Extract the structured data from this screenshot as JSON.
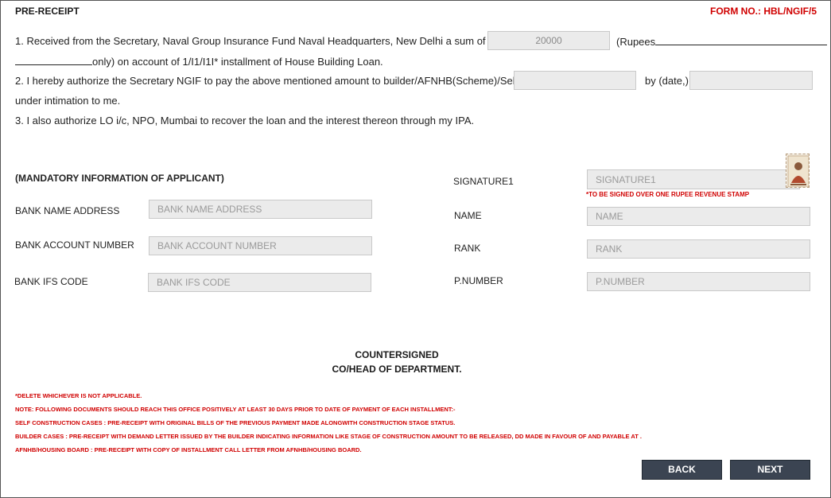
{
  "header": {
    "title": "PRE-RECEIPT",
    "form_no": "FORM NO.: HBL/NGIF/5"
  },
  "clause1": {
    "text_a": "1. Received from the Secretary, Naval Group Insurance Fund Naval Headquarters, New Delhi a sum of Rs",
    "amount_value": "20000",
    "rupees_label": "(Rupees",
    "text_b": "only) on account of 1/I1/I1I* installment of House Building Loan."
  },
  "clause2": {
    "text_a": "2. I hereby authorize the Secretary NGIF to pay the above mentioned amount to builder/AFNHB(Scheme)/Self",
    "by_date_label": "by (date,)",
    "text_b": "under  intimation to me."
  },
  "clause3": {
    "text": "3. I also authorize LO i/c, NPO, Mumbai to recover the loan and the interest thereon through my IPA."
  },
  "applicant": {
    "section_title": "(MANDATORY INFORMATION OF APPLICANT)",
    "bank_name_label": "BANK NAME ADDRESS",
    "bank_name_placeholder": "BANK NAME ADDRESS",
    "bank_account_label": "BANK ACCOUNT NUMBER",
    "bank_account_placeholder": "BANK ACCOUNT NUMBER",
    "bank_ifs_label": "BANK IFS CODE",
    "bank_ifs_placeholder": "BANK IFS CODE"
  },
  "signatory": {
    "signature_label": "SIGNATURE1",
    "signature_placeholder": "SIGNATURE1",
    "stamp_note": "*TO BE SIGNED OVER ONE RUPEE REVENUE STAMP",
    "name_label": "NAME",
    "name_placeholder": "NAME",
    "rank_label": "RANK",
    "rank_placeholder": "RANK",
    "pnumber_label": "P.NUMBER",
    "pnumber_placeholder": "P.NUMBER"
  },
  "countersign": {
    "line1": "COUNTERSIGNED",
    "line2": "CO/HEAD OF DEPARTMENT."
  },
  "notes": {
    "delete_note": "*DELETE WHICHEVER IS NOT APPLICABLE.",
    "note_label": "NOTE",
    "note_text": ": FOLLOWING DOCUMENTS SHOULD REACH THIS OFFICE POSITIVELY AT LEAST 30 DAYS PRIOR TO DATE OF PAYMENT OF EACH INSTALLMENT:-",
    "self_label": "SELF CONSTRUCTION CASES",
    "self_text": " : PRE-RECEIPT WITH ORIGINAL BILLS OF THE PREVIOUS PAYMENT MADE ALONGWITH CONSTRUCTION STAGE STATUS.",
    "builder_label": "BUILDER CASES",
    "builder_text": " : PRE-RECEIPT WITH DEMAND LETTER ISSUED BY THE BUILDER INDICATING INFORMATION LIKE STAGE OF CONSTRUCTION AMOUNT TO BE RELEASED, DD MADE IN FAVOUR OF AND PAYABLE AT .",
    "afnhb_label": "AFNHB/HOUSING BOARD",
    "afnhb_text": " : PRE-RECEIPT WITH COPY OF INSTALLMENT CALL LETTER FROM AFNHB/HOUSING BOARD."
  },
  "buttons": {
    "back": "BACK",
    "next": "NEXT"
  },
  "colors": {
    "accent_red": "#d00000",
    "button_bg": "#3b4452",
    "field_bg": "#ebebeb"
  }
}
